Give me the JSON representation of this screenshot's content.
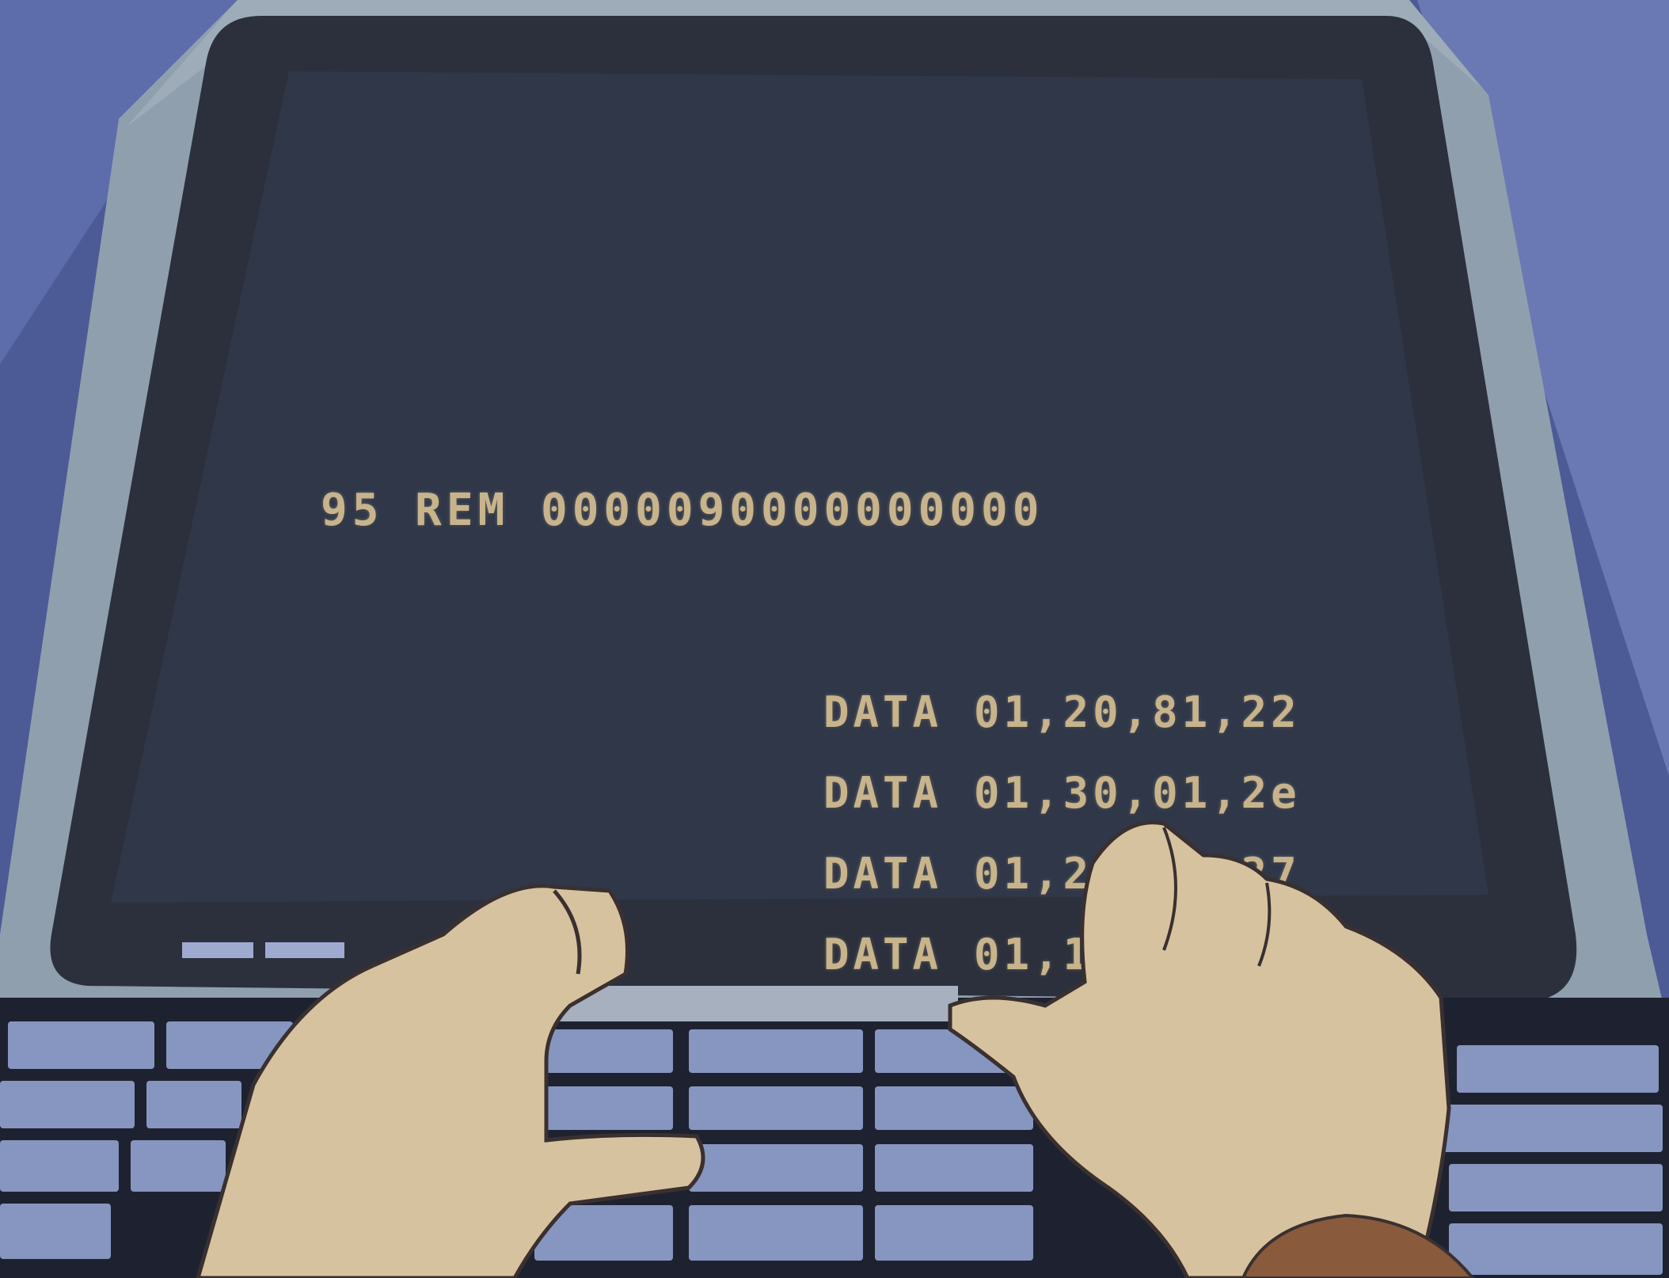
{
  "screen": {
    "rem_line": "95 REM 0000090000000000",
    "data_lines": [
      {
        "keyword": "DATA",
        "values": "01,20,81,22"
      },
      {
        "keyword": "DATA",
        "values": "01,30,01,2e"
      },
      {
        "keyword": "DATA",
        "values": "01,25,81,27"
      },
      {
        "keyword": "DATA",
        "values": "01,1e    14"
      }
    ]
  },
  "colors": {
    "screen_bg": "#2e3442",
    "text": "#c8b48c",
    "bezel": "#8f9fae",
    "background": "#4c5a96",
    "key": "#8796c0",
    "hand": "#d7c2a0"
  },
  "icons": [
    "hands",
    "keyboard",
    "power-indicator"
  ]
}
